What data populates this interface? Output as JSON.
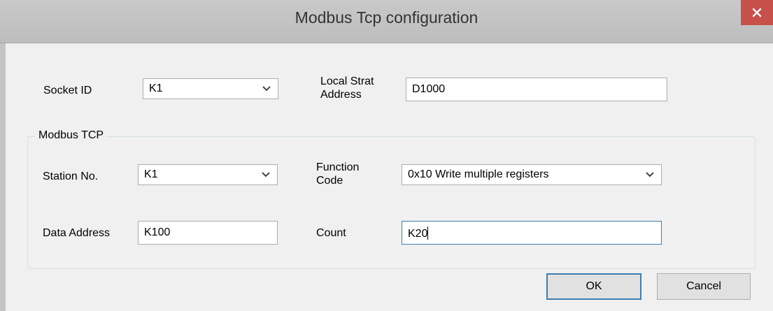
{
  "window": {
    "title": "Modbus Tcp configuration",
    "close_glyph": "✕"
  },
  "fields": {
    "socket_id": {
      "label": "Socket ID",
      "value": "K1"
    },
    "local_start_address": {
      "label_line1": "Local Strat",
      "label_line2": "Address",
      "value": "D1000"
    }
  },
  "modbus_tcp": {
    "group_title": "Modbus TCP",
    "station_no": {
      "label": "Station No.",
      "value": "K1"
    },
    "function_code": {
      "label_line1": "Function",
      "label_line2": "Code",
      "value": "0x10 Write multiple registers"
    },
    "data_address": {
      "label": "Data Address",
      "value": "K100"
    },
    "count": {
      "label": "Count",
      "value": "K20"
    }
  },
  "buttons": {
    "ok": "OK",
    "cancel": "Cancel"
  },
  "icons": {
    "close": "close-icon",
    "dropdown": "chevron-down-icon"
  },
  "colors": {
    "titlebar": "#bdbdbd",
    "close_button": "#c7504b",
    "focus_border": "#3c7fb1",
    "dialog_background": "#f0f0f0"
  }
}
